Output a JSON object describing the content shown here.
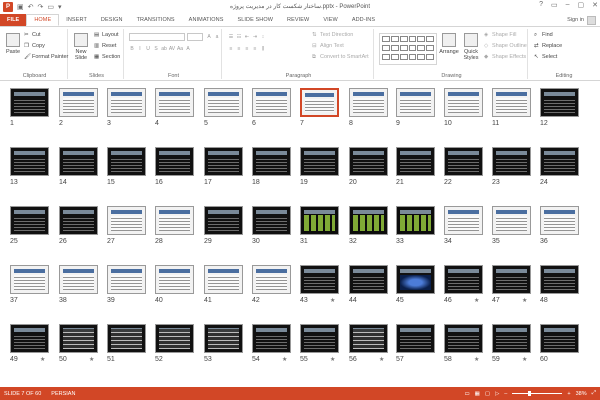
{
  "app": {
    "title": "ساختار شکست کار در مدیریت پروژه.pptx - PowerPoint",
    "logo_letter": "P",
    "win_controls": [
      "?",
      "▭",
      "–",
      "▢",
      "✕"
    ]
  },
  "tabs": [
    {
      "label": "FILE"
    },
    {
      "label": "HOME"
    },
    {
      "label": "INSERT"
    },
    {
      "label": "DESIGN"
    },
    {
      "label": "TRANSITIONS"
    },
    {
      "label": "ANIMATIONS"
    },
    {
      "label": "SLIDE SHOW"
    },
    {
      "label": "REVIEW"
    },
    {
      "label": "VIEW"
    },
    {
      "label": "ADD-INS"
    }
  ],
  "signin": "Sign in",
  "ribbon": {
    "clipboard": {
      "name": "Clipboard",
      "paste": "Paste",
      "cut": "Cut",
      "copy": "Copy",
      "format_painter": "Format Painter"
    },
    "slides": {
      "name": "Slides",
      "new_slide": "New Slide",
      "layout": "Layout",
      "reset": "Reset",
      "section": "Section"
    },
    "font": {
      "name": "Font"
    },
    "paragraph": {
      "name": "Paragraph",
      "text_direction": "Text Direction",
      "align_text": "Align Text",
      "convert": "Convert to SmartArt"
    },
    "drawing": {
      "name": "Drawing",
      "arrange": "Arrange",
      "quick_styles": "Quick Styles",
      "shape_fill": "Shape Fill",
      "shape_outline": "Shape Outline",
      "shape_effects": "Shape Effects"
    },
    "editing": {
      "name": "Editing",
      "find": "Find",
      "replace": "Replace",
      "select": "Select"
    }
  },
  "slides": [
    {
      "n": "1",
      "star": false,
      "style": "dark"
    },
    {
      "n": "2",
      "star": false,
      "style": "white"
    },
    {
      "n": "3",
      "star": false,
      "style": "white"
    },
    {
      "n": "4",
      "star": false,
      "style": "white"
    },
    {
      "n": "5",
      "star": false,
      "style": "white"
    },
    {
      "n": "6",
      "star": false,
      "style": "white"
    },
    {
      "n": "7",
      "star": false,
      "style": "white",
      "selected": true
    },
    {
      "n": "8",
      "star": false,
      "style": "white"
    },
    {
      "n": "9",
      "star": false,
      "style": "white"
    },
    {
      "n": "10",
      "star": false,
      "style": "white"
    },
    {
      "n": "11",
      "star": false,
      "style": "white"
    },
    {
      "n": "12",
      "star": false,
      "style": "dark"
    },
    {
      "n": "13",
      "star": false,
      "style": "dark"
    },
    {
      "n": "14",
      "star": false,
      "style": "dark"
    },
    {
      "n": "15",
      "star": false,
      "style": "dark"
    },
    {
      "n": "16",
      "star": false,
      "style": "dark"
    },
    {
      "n": "17",
      "star": false,
      "style": "dark"
    },
    {
      "n": "18",
      "star": false,
      "style": "dark"
    },
    {
      "n": "19",
      "star": false,
      "style": "dark"
    },
    {
      "n": "20",
      "star": false,
      "style": "dark"
    },
    {
      "n": "21",
      "star": false,
      "style": "dark"
    },
    {
      "n": "22",
      "star": false,
      "style": "dark"
    },
    {
      "n": "23",
      "star": false,
      "style": "dark"
    },
    {
      "n": "24",
      "star": false,
      "style": "dark"
    },
    {
      "n": "25",
      "star": false,
      "style": "dark"
    },
    {
      "n": "26",
      "star": false,
      "style": "dark"
    },
    {
      "n": "27",
      "star": false,
      "style": "white"
    },
    {
      "n": "28",
      "star": false,
      "style": "white"
    },
    {
      "n": "29",
      "star": false,
      "style": "dark"
    },
    {
      "n": "30",
      "star": false,
      "style": "dark"
    },
    {
      "n": "31",
      "star": false,
      "style": "green"
    },
    {
      "n": "32",
      "star": false,
      "style": "green"
    },
    {
      "n": "33",
      "star": false,
      "style": "green"
    },
    {
      "n": "34",
      "star": false,
      "style": "white"
    },
    {
      "n": "35",
      "star": false,
      "style": "white"
    },
    {
      "n": "36",
      "star": false,
      "style": "white"
    },
    {
      "n": "37",
      "star": false,
      "style": "white"
    },
    {
      "n": "38",
      "star": false,
      "style": "white"
    },
    {
      "n": "39",
      "star": false,
      "style": "white"
    },
    {
      "n": "40",
      "star": false,
      "style": "white"
    },
    {
      "n": "41",
      "star": false,
      "style": "white"
    },
    {
      "n": "42",
      "star": false,
      "style": "white"
    },
    {
      "n": "43",
      "star": true,
      "style": "dark"
    },
    {
      "n": "44",
      "star": false,
      "style": "dark"
    },
    {
      "n": "45",
      "star": false,
      "style": "blue"
    },
    {
      "n": "46",
      "star": true,
      "style": "dark"
    },
    {
      "n": "47",
      "star": true,
      "style": "dark"
    },
    {
      "n": "48",
      "star": false,
      "style": "dark"
    },
    {
      "n": "49",
      "star": true,
      "style": "dark"
    },
    {
      "n": "50",
      "star": true,
      "style": "gray"
    },
    {
      "n": "51",
      "star": false,
      "style": "gray"
    },
    {
      "n": "52",
      "star": false,
      "style": "gray"
    },
    {
      "n": "53",
      "star": false,
      "style": "gray"
    },
    {
      "n": "54",
      "star": true,
      "style": "dark"
    },
    {
      "n": "55",
      "star": true,
      "style": "dark"
    },
    {
      "n": "56",
      "star": true,
      "style": "gray"
    },
    {
      "n": "57",
      "star": false,
      "style": "dark"
    },
    {
      "n": "58",
      "star": true,
      "style": "dark"
    },
    {
      "n": "59",
      "star": true,
      "style": "dark"
    },
    {
      "n": "60",
      "star": false,
      "style": "dark"
    }
  ],
  "status": {
    "slide_of": "SLIDE 7 OF 60",
    "language": "PERSIAN",
    "zoom": "38%"
  },
  "colors": {
    "accent": "#d24726",
    "selected_border": "#d24726"
  }
}
